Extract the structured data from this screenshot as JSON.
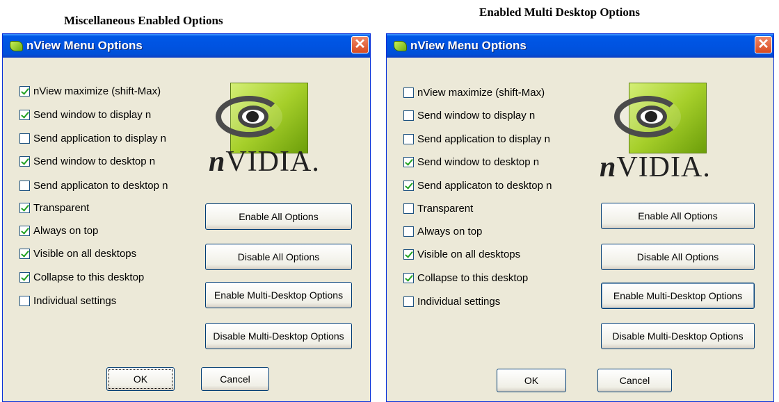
{
  "captions": {
    "left": "Miscellaneous Enabled Options",
    "right": "Enabled Multi Desktop Options"
  },
  "dialogs": [
    {
      "title": "nView Menu Options",
      "close_glyph": "✕",
      "logo_wordmark": "VIDIA.",
      "logo_wordmark_prefix": "n",
      "options": [
        {
          "label": "nView maximize (shift-Max)",
          "checked": true
        },
        {
          "label": "Send window to display n",
          "checked": true
        },
        {
          "label": "Send application to display n",
          "checked": false
        },
        {
          "label": "Send window to desktop n",
          "checked": true
        },
        {
          "label": "Send applicaton to desktop n",
          "checked": false
        },
        {
          "label": "Transparent",
          "checked": true
        },
        {
          "label": "Always on top",
          "checked": true
        },
        {
          "label": "Visible on all desktops",
          "checked": true
        },
        {
          "label": "Collapse to this desktop",
          "checked": true
        },
        {
          "label": "Individual settings",
          "checked": false
        }
      ],
      "buttons": {
        "enable_all": "Enable All Options",
        "disable_all": "Disable All Options",
        "enable_multi": "Enable Multi-Desktop Options",
        "disable_multi": "Disable Multi-Desktop Options",
        "ok": "OK",
        "cancel": "Cancel"
      }
    },
    {
      "title": "nView Menu Options",
      "close_glyph": "✕",
      "logo_wordmark": "VIDIA.",
      "logo_wordmark_prefix": "n",
      "options": [
        {
          "label": "nView maximize (shift-Max)",
          "checked": false
        },
        {
          "label": "Send window to display n",
          "checked": false
        },
        {
          "label": "Send application to display n",
          "checked": false
        },
        {
          "label": "Send window to desktop n",
          "checked": true
        },
        {
          "label": "Send applicaton to desktop n",
          "checked": true
        },
        {
          "label": "Transparent",
          "checked": false
        },
        {
          "label": "Always on top",
          "checked": false
        },
        {
          "label": "Visible on all desktops",
          "checked": true
        },
        {
          "label": "Collapse to this desktop",
          "checked": true
        },
        {
          "label": "Individual settings",
          "checked": false
        }
      ],
      "buttons": {
        "enable_all": "Enable All Options",
        "disable_all": "Disable All Options",
        "enable_multi": "Enable Multi-Desktop Options",
        "disable_multi": "Disable Multi-Desktop Options",
        "ok": "OK",
        "cancel": "Cancel"
      }
    }
  ],
  "colors": {
    "titlebar": "#0053e1",
    "dialog_bg": "#ece9d8",
    "checkmark": "#21a121",
    "close_button": "#d84a20",
    "logo_green": "#a6cf2a"
  }
}
